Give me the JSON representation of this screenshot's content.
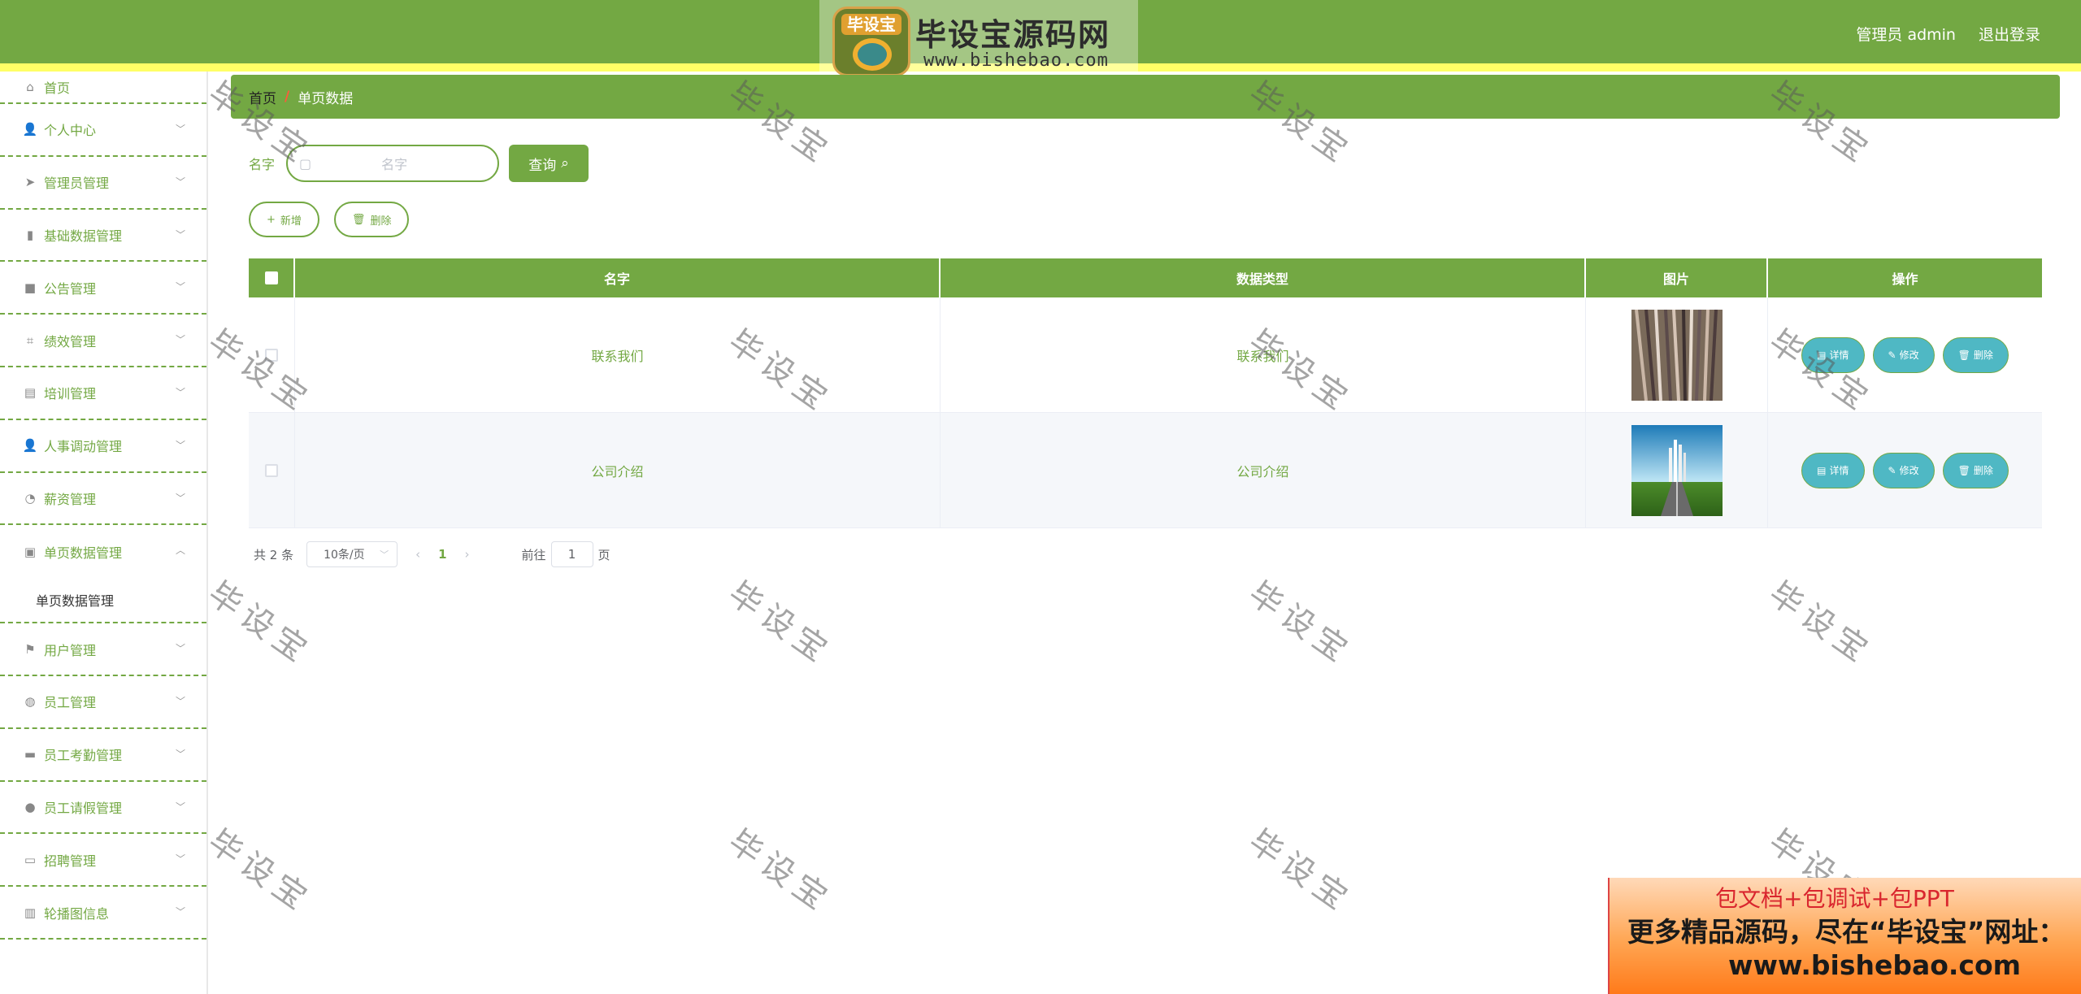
{
  "header": {
    "logo_badge": "毕设宝",
    "logo_title": "毕设宝源码网",
    "logo_url": "www.bishebao.com",
    "user_label": "管理员 admin",
    "logout_label": "退出登录",
    "brand_color": "#73a843"
  },
  "sidebar": {
    "items": [
      {
        "label": "首页",
        "icon": "home-icon"
      },
      {
        "label": "个人中心",
        "icon": "user-icon"
      },
      {
        "label": "管理员管理",
        "icon": "send-icon"
      },
      {
        "label": "基础数据管理",
        "icon": "bell-icon"
      },
      {
        "label": "公告管理",
        "icon": "bag-icon"
      },
      {
        "label": "绩效管理",
        "icon": "crop-icon"
      },
      {
        "label": "培训管理",
        "icon": "clipboard-icon"
      },
      {
        "label": "人事调动管理",
        "icon": "user-icon"
      },
      {
        "label": "薪资管理",
        "icon": "gauge-icon"
      },
      {
        "label": "单页数据管理",
        "icon": "picture-icon"
      },
      {
        "label": "用户管理",
        "icon": "flag-icon"
      },
      {
        "label": "员工管理",
        "icon": "compass-icon"
      },
      {
        "label": "员工考勤管理",
        "icon": "ticket-icon"
      },
      {
        "label": "员工请假管理",
        "icon": "location-icon"
      },
      {
        "label": "招聘管理",
        "icon": "monitor-icon"
      },
      {
        "label": "轮播图信息",
        "icon": "chart-icon"
      }
    ],
    "submenu_label": "单页数据管理"
  },
  "breadcrumb": {
    "home": "首页",
    "separator": "/",
    "current": "单页数据"
  },
  "search": {
    "label": "名字",
    "placeholder": "名字",
    "button_label": "查询"
  },
  "actions": {
    "add_label": "新增",
    "delete_label": "删除"
  },
  "table": {
    "headers": [
      "名字",
      "数据类型",
      "图片",
      "操作"
    ],
    "rows": [
      {
        "name": "联系我们",
        "type": "联系我们",
        "image": "striped-photo"
      },
      {
        "name": "公司介绍",
        "type": "公司介绍",
        "image": "road-sky-photo"
      }
    ],
    "row_actions": {
      "detail": "详情",
      "edit": "修改",
      "delete": "删除"
    }
  },
  "pagination": {
    "total": "共 2 条",
    "page_size": "10条/页",
    "current_page": "1",
    "goto_prefix": "前往",
    "goto_value": "1",
    "goto_suffix": "页"
  },
  "watermark_text": "毕设宝",
  "promo": {
    "line1": "包文档+包调试+包PPT",
    "line2": "更多精品源码，尽在“毕设宝”网址：",
    "line3": "www.bishebao.com"
  }
}
